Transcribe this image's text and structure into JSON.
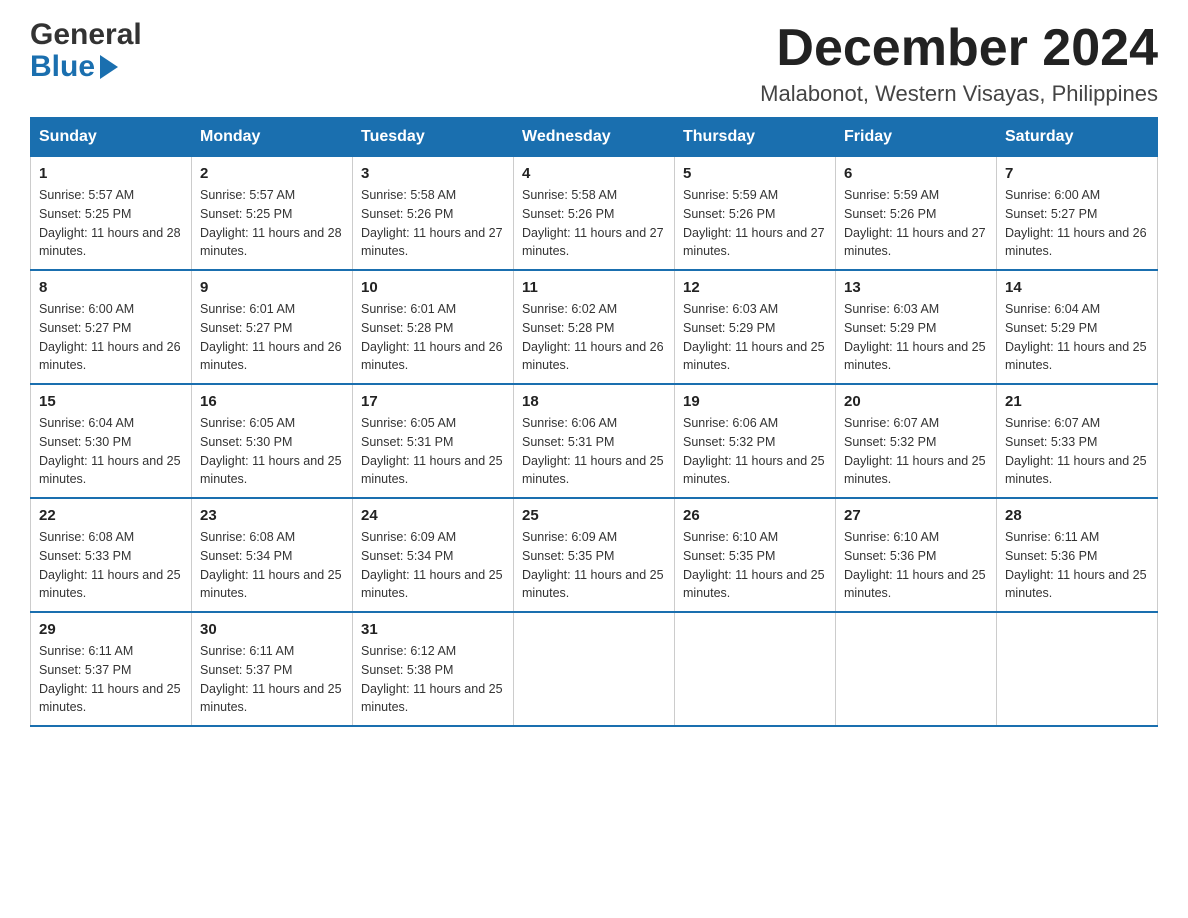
{
  "logo": {
    "general": "General",
    "blue": "Blue",
    "arrow": "▶"
  },
  "title": "December 2024",
  "subtitle": "Malabonot, Western Visayas, Philippines",
  "days_of_week": [
    "Sunday",
    "Monday",
    "Tuesday",
    "Wednesday",
    "Thursday",
    "Friday",
    "Saturday"
  ],
  "weeks": [
    [
      {
        "day": "1",
        "sunrise": "5:57 AM",
        "sunset": "5:25 PM",
        "daylight": "11 hours and 28 minutes."
      },
      {
        "day": "2",
        "sunrise": "5:57 AM",
        "sunset": "5:25 PM",
        "daylight": "11 hours and 28 minutes."
      },
      {
        "day": "3",
        "sunrise": "5:58 AM",
        "sunset": "5:26 PM",
        "daylight": "11 hours and 27 minutes."
      },
      {
        "day": "4",
        "sunrise": "5:58 AM",
        "sunset": "5:26 PM",
        "daylight": "11 hours and 27 minutes."
      },
      {
        "day": "5",
        "sunrise": "5:59 AM",
        "sunset": "5:26 PM",
        "daylight": "11 hours and 27 minutes."
      },
      {
        "day": "6",
        "sunrise": "5:59 AM",
        "sunset": "5:26 PM",
        "daylight": "11 hours and 27 minutes."
      },
      {
        "day": "7",
        "sunrise": "6:00 AM",
        "sunset": "5:27 PM",
        "daylight": "11 hours and 26 minutes."
      }
    ],
    [
      {
        "day": "8",
        "sunrise": "6:00 AM",
        "sunset": "5:27 PM",
        "daylight": "11 hours and 26 minutes."
      },
      {
        "day": "9",
        "sunrise": "6:01 AM",
        "sunset": "5:27 PM",
        "daylight": "11 hours and 26 minutes."
      },
      {
        "day": "10",
        "sunrise": "6:01 AM",
        "sunset": "5:28 PM",
        "daylight": "11 hours and 26 minutes."
      },
      {
        "day": "11",
        "sunrise": "6:02 AM",
        "sunset": "5:28 PM",
        "daylight": "11 hours and 26 minutes."
      },
      {
        "day": "12",
        "sunrise": "6:03 AM",
        "sunset": "5:29 PM",
        "daylight": "11 hours and 25 minutes."
      },
      {
        "day": "13",
        "sunrise": "6:03 AM",
        "sunset": "5:29 PM",
        "daylight": "11 hours and 25 minutes."
      },
      {
        "day": "14",
        "sunrise": "6:04 AM",
        "sunset": "5:29 PM",
        "daylight": "11 hours and 25 minutes."
      }
    ],
    [
      {
        "day": "15",
        "sunrise": "6:04 AM",
        "sunset": "5:30 PM",
        "daylight": "11 hours and 25 minutes."
      },
      {
        "day": "16",
        "sunrise": "6:05 AM",
        "sunset": "5:30 PM",
        "daylight": "11 hours and 25 minutes."
      },
      {
        "day": "17",
        "sunrise": "6:05 AM",
        "sunset": "5:31 PM",
        "daylight": "11 hours and 25 minutes."
      },
      {
        "day": "18",
        "sunrise": "6:06 AM",
        "sunset": "5:31 PM",
        "daylight": "11 hours and 25 minutes."
      },
      {
        "day": "19",
        "sunrise": "6:06 AM",
        "sunset": "5:32 PM",
        "daylight": "11 hours and 25 minutes."
      },
      {
        "day": "20",
        "sunrise": "6:07 AM",
        "sunset": "5:32 PM",
        "daylight": "11 hours and 25 minutes."
      },
      {
        "day": "21",
        "sunrise": "6:07 AM",
        "sunset": "5:33 PM",
        "daylight": "11 hours and 25 minutes."
      }
    ],
    [
      {
        "day": "22",
        "sunrise": "6:08 AM",
        "sunset": "5:33 PM",
        "daylight": "11 hours and 25 minutes."
      },
      {
        "day": "23",
        "sunrise": "6:08 AM",
        "sunset": "5:34 PM",
        "daylight": "11 hours and 25 minutes."
      },
      {
        "day": "24",
        "sunrise": "6:09 AM",
        "sunset": "5:34 PM",
        "daylight": "11 hours and 25 minutes."
      },
      {
        "day": "25",
        "sunrise": "6:09 AM",
        "sunset": "5:35 PM",
        "daylight": "11 hours and 25 minutes."
      },
      {
        "day": "26",
        "sunrise": "6:10 AM",
        "sunset": "5:35 PM",
        "daylight": "11 hours and 25 minutes."
      },
      {
        "day": "27",
        "sunrise": "6:10 AM",
        "sunset": "5:36 PM",
        "daylight": "11 hours and 25 minutes."
      },
      {
        "day": "28",
        "sunrise": "6:11 AM",
        "sunset": "5:36 PM",
        "daylight": "11 hours and 25 minutes."
      }
    ],
    [
      {
        "day": "29",
        "sunrise": "6:11 AM",
        "sunset": "5:37 PM",
        "daylight": "11 hours and 25 minutes."
      },
      {
        "day": "30",
        "sunrise": "6:11 AM",
        "sunset": "5:37 PM",
        "daylight": "11 hours and 25 minutes."
      },
      {
        "day": "31",
        "sunrise": "6:12 AM",
        "sunset": "5:38 PM",
        "daylight": "11 hours and 25 minutes."
      },
      null,
      null,
      null,
      null
    ]
  ],
  "labels": {
    "sunrise": "Sunrise: ",
    "sunset": "Sunset: ",
    "daylight": "Daylight: "
  }
}
